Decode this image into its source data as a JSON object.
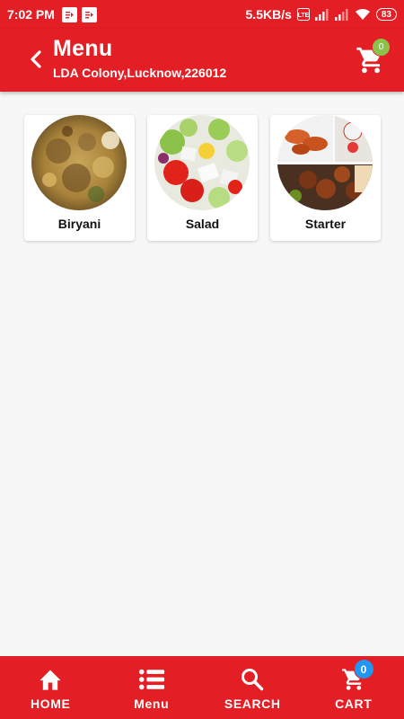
{
  "status_bar": {
    "time": "7:02 PM",
    "network_speed": "5.5KB/s",
    "battery": "83",
    "icons": [
      "notification-icon",
      "notification-icon",
      "volte-icon",
      "signal-icon",
      "signal-icon",
      "wifi-icon",
      "battery-icon"
    ]
  },
  "app_bar": {
    "title": "Menu",
    "location": "LDA Colony,Lucknow,226012",
    "cart_count": "0",
    "back_icon": "chevron-left-icon",
    "cart_icon": "cart-icon",
    "color": "#e31e24",
    "badge_color": "#8bc34a"
  },
  "categories": [
    {
      "label": "Biryani",
      "image": "biryani-photo"
    },
    {
      "label": "Salad",
      "image": "salad-photo"
    },
    {
      "label": "Starter",
      "image": "starter-photo"
    }
  ],
  "bottom_nav": {
    "items": [
      {
        "label": "HOME",
        "icon": "home-icon"
      },
      {
        "label": "Menu",
        "icon": "list-icon"
      },
      {
        "label": "SEARCH",
        "icon": "search-icon"
      },
      {
        "label": "CART",
        "icon": "cart-icon"
      }
    ],
    "cart_count": "0",
    "badge_color": "#2196f3"
  }
}
